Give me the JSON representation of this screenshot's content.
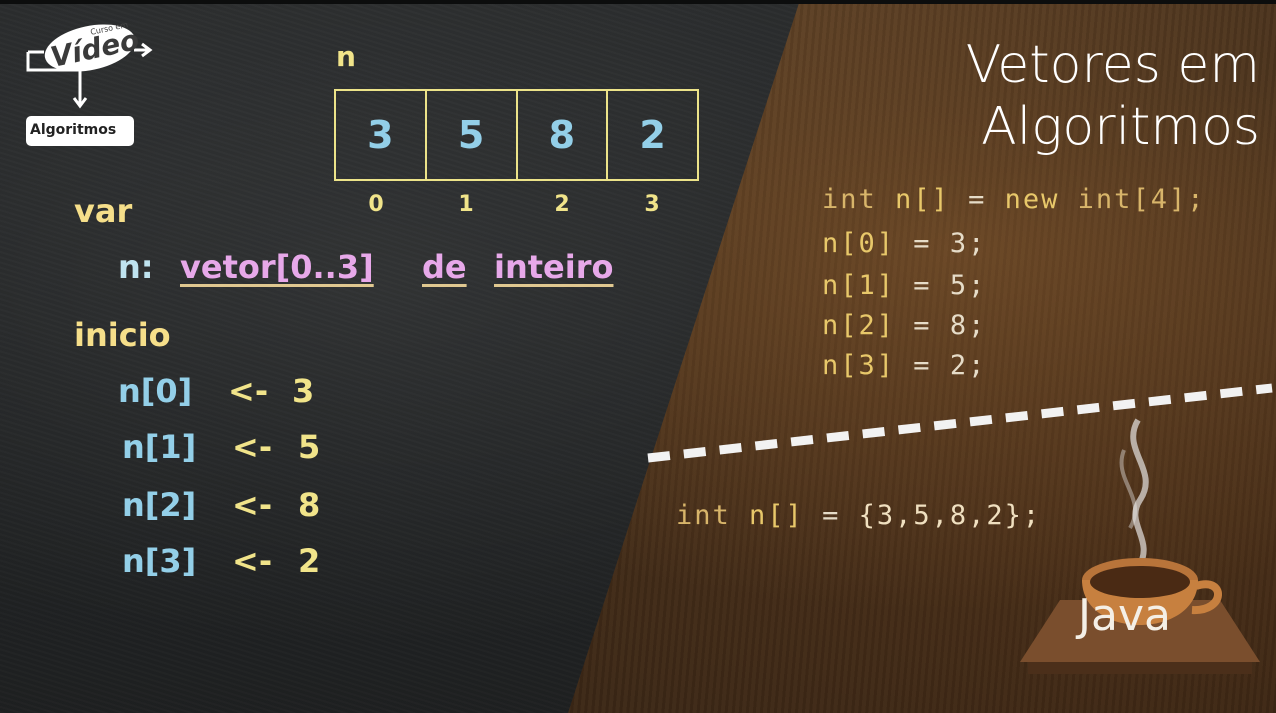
{
  "logo": {
    "badge_text": "Vídeo",
    "badge_small": "Curso em",
    "algo_text": "Algoritmos"
  },
  "title": {
    "line1": "Vetores em",
    "line2": "Algoritmos"
  },
  "array": {
    "name": "n",
    "values": [
      "3",
      "5",
      "8",
      "2"
    ],
    "indices": [
      "0",
      "1",
      "2",
      "3"
    ]
  },
  "pseudo": {
    "kw_var": "var",
    "decl_n": "n:",
    "decl_type": "vetor[0..3]",
    "decl_de": "de",
    "decl_inteiro": "inteiro",
    "kw_inicio": "inicio",
    "lines": [
      {
        "lhs": "n[0]",
        "op": "<-",
        "rhs": "3"
      },
      {
        "lhs": "n[1]",
        "op": "<-",
        "rhs": "5"
      },
      {
        "lhs": "n[2]",
        "op": "<-",
        "rhs": "8"
      },
      {
        "lhs": "n[3]",
        "op": "<-",
        "rhs": "2"
      }
    ]
  },
  "java": {
    "line0": {
      "a": "int",
      "b": "n[]",
      "c": "=",
      "d": "new",
      "e": "int[4];"
    },
    "assigns": [
      {
        "lhs": "n[0]",
        "eq": "=",
        "rhs": "3;"
      },
      {
        "lhs": "n[1]",
        "eq": "=",
        "rhs": "5;"
      },
      {
        "lhs": "n[2]",
        "eq": "=",
        "rhs": "8;"
      },
      {
        "lhs": "n[3]",
        "eq": "=",
        "rhs": "2;"
      }
    ],
    "inline": {
      "a": "int",
      "b": "n[]",
      "c": "=",
      "d": "{3,5,8,2};"
    },
    "logo_text": "Java"
  },
  "colors": {
    "chalk_yellow": "#f1e48a",
    "chalk_blue": "#93cfe8",
    "chalk_pink": "#e7a8e9",
    "code_bracket": "#f0c44a"
  }
}
